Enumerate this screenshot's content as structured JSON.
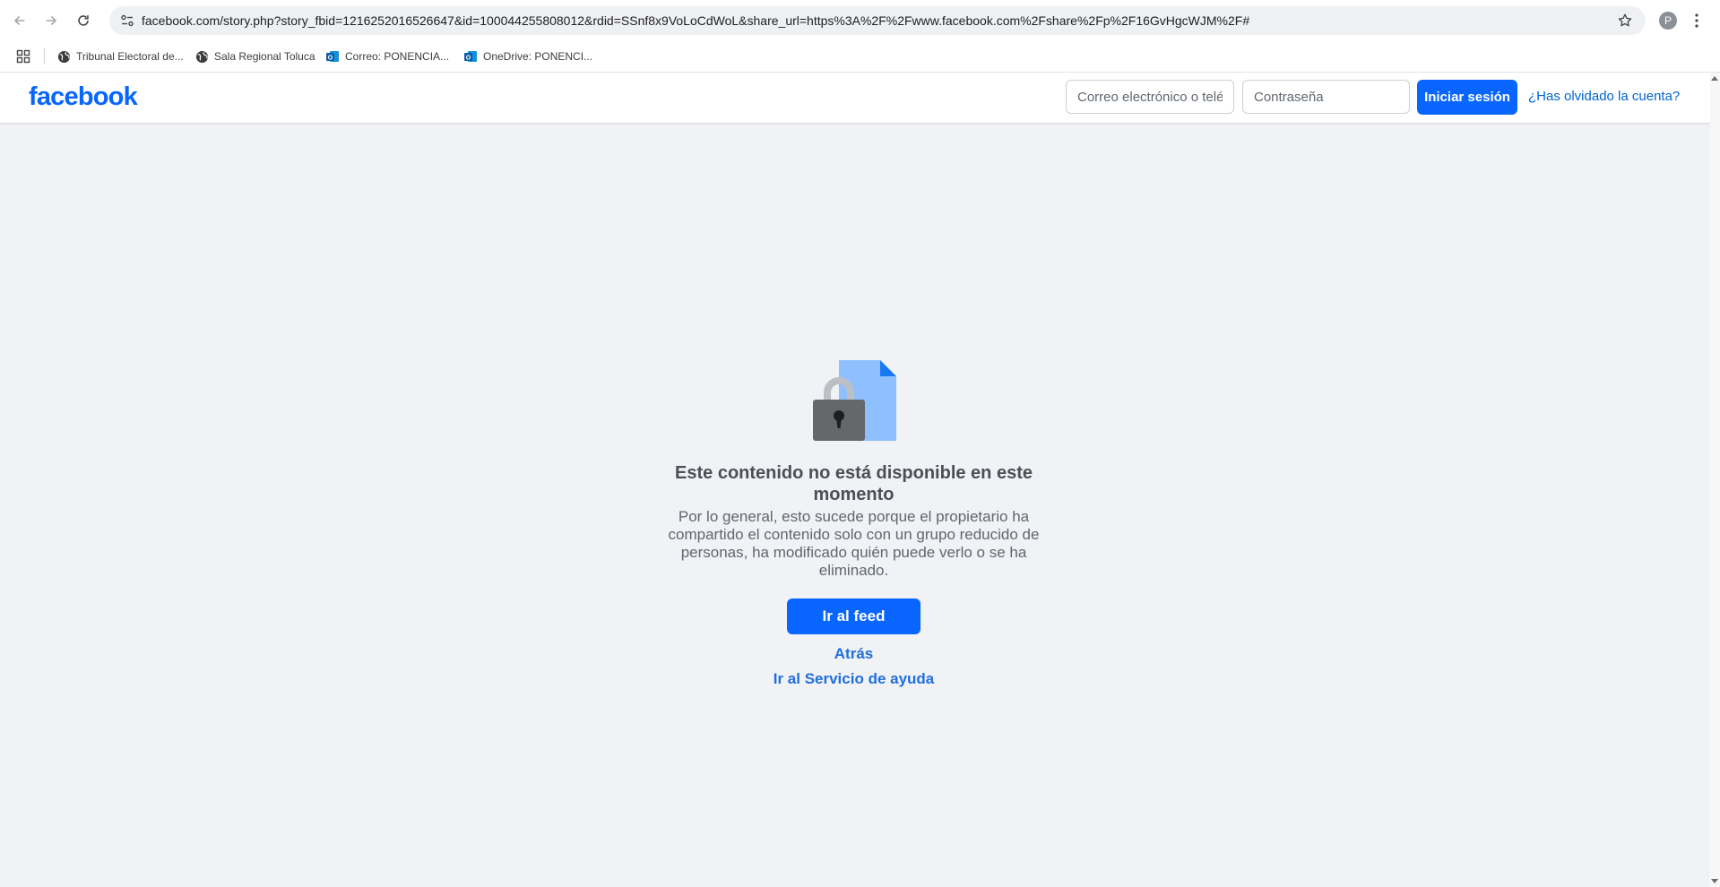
{
  "browser": {
    "url": "facebook.com/story.php?story_fbid=1216252016526647&id=100044255808012&rdid=SSnf8x9VoLoCdWoL&share_url=https%3A%2F%2Fwww.facebook.com%2Fshare%2Fp%2F16GvHgcWJM%2F#",
    "profile_initial": "P",
    "bookmarks": [
      {
        "label": "Tribunal Electoral de...",
        "icon": "globe-icon"
      },
      {
        "label": "Sala Regional Toluca",
        "icon": "globe-icon"
      },
      {
        "label": "Correo: PONENCIA...",
        "icon": "outlook-icon"
      },
      {
        "label": "OneDrive: PONENCI...",
        "icon": "outlook-icon"
      }
    ]
  },
  "header": {
    "logo": "facebook",
    "email_placeholder": "Correo electrónico o teléfono",
    "password_placeholder": "Contraseña",
    "login_label": "Iniciar sesión",
    "forgot_label": "¿Has olvidado la cuenta?"
  },
  "main": {
    "title": "Este contenido no está disponible en este momento",
    "description": "Por lo general, esto sucede porque el propietario ha compartido el contenido solo con un grupo reducido de personas, ha modificado quién puede verlo o se ha eliminado.",
    "feed_button": "Ir al feed",
    "back_link": "Atrás",
    "help_link": "Ir al Servicio de ayuda"
  },
  "colors": {
    "brand": "#0866ff",
    "link": "#216fdb",
    "background": "#f0f2f5",
    "document": "#8ec0ff",
    "lock_body": "#65676b",
    "lock_shackle": "#bcc0c4"
  }
}
